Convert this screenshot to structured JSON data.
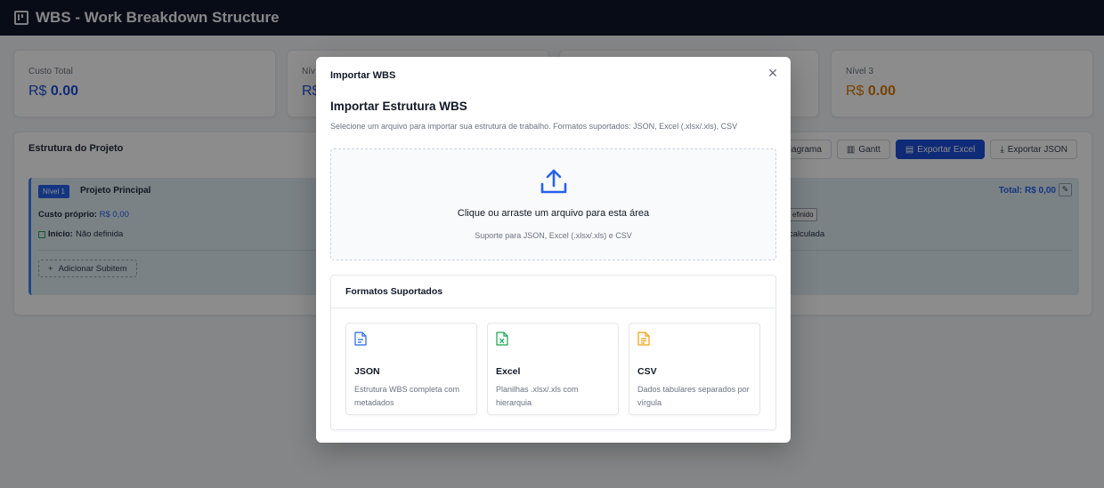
{
  "header": {
    "title": "WBS - Work Breakdown Structure"
  },
  "stats": [
    {
      "label": "Custo Total",
      "currency": "R$",
      "value": "0.00",
      "color": "#1d4ed8"
    },
    {
      "label": "Nív",
      "currency": "R$",
      "value": "",
      "color": "#1d4ed8"
    },
    {
      "label": "",
      "currency": "",
      "value": "",
      "color": "#1d4ed8"
    },
    {
      "label": "Nível 3",
      "currency": "R$",
      "value": "0.00",
      "color": "#d97706"
    }
  ],
  "project": {
    "title": "Estrutura do Projeto",
    "actions": {
      "diagram": "Diagrama",
      "gantt": "Gantt",
      "export_excel": "Exportar Excel",
      "export_json": "Exportar JSON"
    },
    "node": {
      "badge": "Nível 1",
      "name": "Projeto Principal",
      "own_cost_label": "Custo próprio:",
      "own_cost_value": "R$ 0,00",
      "start_label": "Início:",
      "start_value": "Não definida",
      "add_subitem": "Adicionar Subitem",
      "total": "Total: R$ 0,00",
      "right_tag": "efinido",
      "right_text": "calculada"
    }
  },
  "modal": {
    "title": "Importar WBS",
    "heading": "Importar Estrutura WBS",
    "description": "Selecione um arquivo para importar sua estrutura de trabalho. Formatos suportados: JSON, Excel (.xlsx/.xls), CSV",
    "dropzone": {
      "text": "Clique ou arraste um arquivo para esta área",
      "subtext": "Suporte para JSON, Excel (.xlsx/.xls) e CSV"
    },
    "formats_title": "Formatos Suportados",
    "formats": [
      {
        "name": "JSON",
        "description": "Estrutura WBS completa com metadados",
        "icon": "json-file-icon",
        "color": "#2563eb"
      },
      {
        "name": "Excel",
        "description": "Planilhas .xlsx/.xls com hierarquia",
        "icon": "excel-file-icon",
        "color": "#16a34a"
      },
      {
        "name": "CSV",
        "description": "Dados tabulares separados por vírgula",
        "icon": "csv-file-icon",
        "color": "#f59e0b"
      }
    ]
  }
}
